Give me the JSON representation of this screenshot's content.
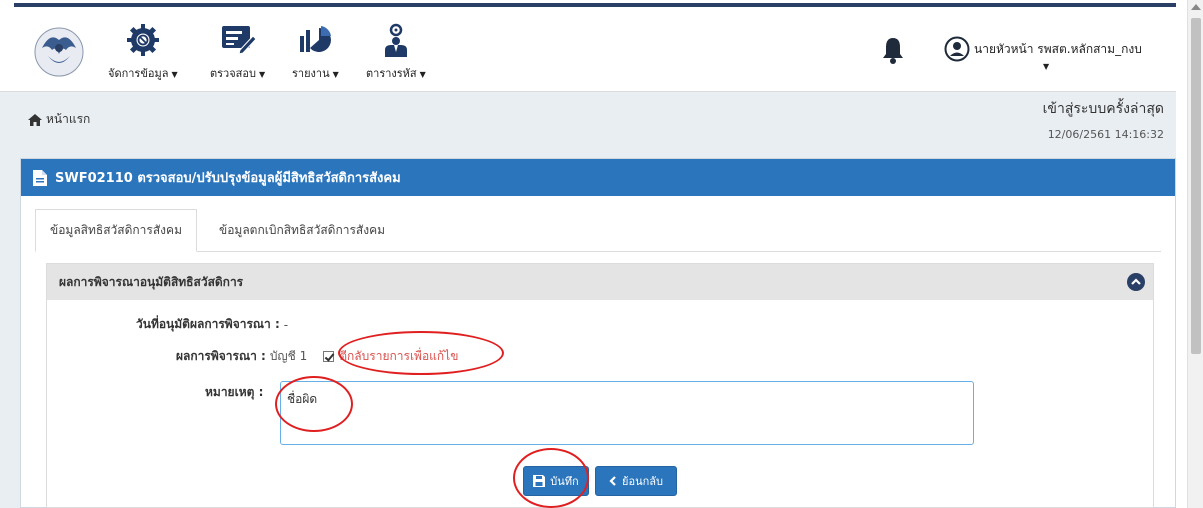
{
  "navbar": {
    "items": [
      {
        "label": "จัดการข้อมูล",
        "icon": "gear-ban-icon"
      },
      {
        "label": "ตรวจสอบ",
        "icon": "edit-list-icon"
      },
      {
        "label": "รายงาน",
        "icon": "chart-report-icon"
      },
      {
        "label": "ตารางรหัส",
        "icon": "user-settings-icon"
      }
    ],
    "caret": "▼",
    "user_name": "นายหัวหน้า รพสต.หลักสาม_กงบ"
  },
  "breadcrumb": {
    "home_label": "หน้าแรก"
  },
  "last_login": {
    "title": "เข้าสู่ระบบครั้งล่าสุด",
    "datetime": "12/06/2561 14:16:32"
  },
  "panel": {
    "title": "SWF02110 ตรวจสอบ/ปรับปรุงข้อมูลผู้มีสิทธิสวัสดิการสังคม"
  },
  "tabs": [
    {
      "label": "ข้อมูลสิทธิสวัสดิการสังคม",
      "active": true
    },
    {
      "label": "ข้อมูลตกเบิกสิทธิสวัสดิการสังคม",
      "active": false
    }
  ],
  "section": {
    "title": "ผลการพิจารณาอนุมัติสิทธิสวัสดิการ",
    "approve_date_label": "วันที่อนุมัติผลการพิจารณา :",
    "approve_date_value": "-",
    "result_label": "ผลการพิจารณา :",
    "result_value": "บัญชี 1",
    "return_checkbox_label": "ตีกลับรายการเพื่อแก้ไข",
    "note_label": "หมายเหตุ :",
    "note_value": "ชื่อผิด"
  },
  "buttons": {
    "save": "บันทึก",
    "back": "ย้อนกลับ"
  },
  "colors": {
    "primary": "#2b75bd",
    "navy": "#2a3f66",
    "danger": "#d9534f",
    "annotation": "#e02020"
  }
}
